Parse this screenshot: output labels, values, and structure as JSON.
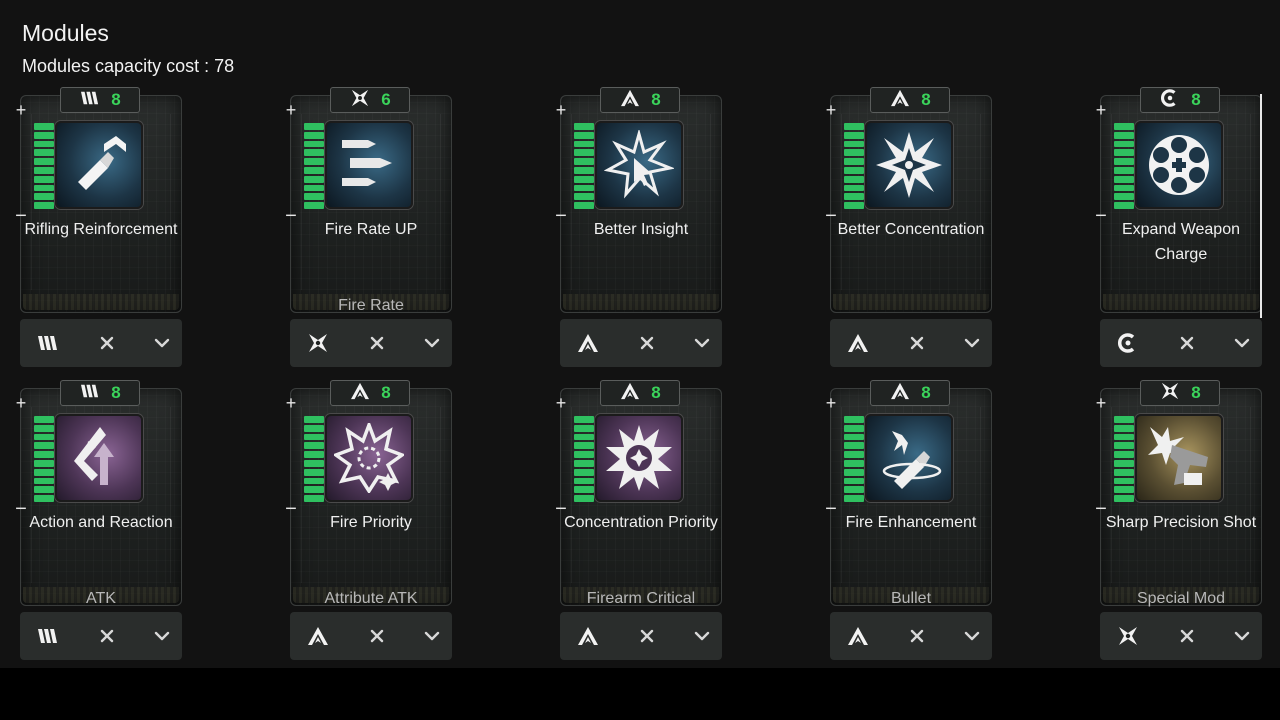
{
  "header": {
    "title": "Modules",
    "capacity_label": "Modules capacity cost : 78"
  },
  "colors": {
    "cost_green": "#3ad35a",
    "level_green": "#2fc060",
    "icon_blue": "#1d3546",
    "icon_purple": "#4d3556",
    "icon_gold": "#5a4f32"
  },
  "modules": [
    {
      "name": "Rifling Reinforcement",
      "type": "",
      "cost": "8",
      "socket": "iron-bars-icon",
      "icon": "bullet-upgrade-icon",
      "tint": "blue",
      "level": 10
    },
    {
      "name": "Fire Rate UP",
      "type": "Fire Rate",
      "cost": "6",
      "socket": "xantic-star-icon",
      "icon": "bullet-stack-icon",
      "tint": "blue",
      "level": 10
    },
    {
      "name": "Better Insight",
      "type": "",
      "cost": "8",
      "socket": "almandine-chevron-icon",
      "icon": "burst-cursor-icon",
      "tint": "blue",
      "level": 10
    },
    {
      "name": "Better Concentration",
      "type": "",
      "cost": "8",
      "socket": "almandine-chevron-icon",
      "icon": "starburst-icon",
      "tint": "blue",
      "level": 10
    },
    {
      "name": "Expand Weapon Charge",
      "type": "",
      "cost": "8",
      "socket": "cerulean-ring-icon",
      "icon": "revolver-cylinder-icon",
      "tint": "blue",
      "level": 10
    },
    {
      "name": "Action and Reaction",
      "type": "ATK",
      "cost": "8",
      "socket": "iron-bars-icon",
      "icon": "recoil-arrow-icon",
      "tint": "purple",
      "level": 10
    },
    {
      "name": "Fire Priority",
      "type": "Attribute ATK",
      "cost": "8",
      "socket": "almandine-chevron-icon",
      "icon": "burst-ring-icon",
      "tint": "purple",
      "level": 10
    },
    {
      "name": "Concentration Priority",
      "type": "Firearm Critical",
      "cost": "8",
      "socket": "almandine-chevron-icon",
      "icon": "star-ring-icon",
      "tint": "purple",
      "level": 10
    },
    {
      "name": "Fire Enhancement",
      "type": "Bullet",
      "cost": "8",
      "socket": "almandine-chevron-icon",
      "icon": "flaming-bullet-icon",
      "tint": "blue",
      "level": 10
    },
    {
      "name": "Sharp Precision Shot",
      "type": "Special Mod",
      "cost": "8",
      "socket": "xantic-star-icon",
      "icon": "pistol-burst-icon",
      "tint": "gold",
      "level": 10
    }
  ]
}
